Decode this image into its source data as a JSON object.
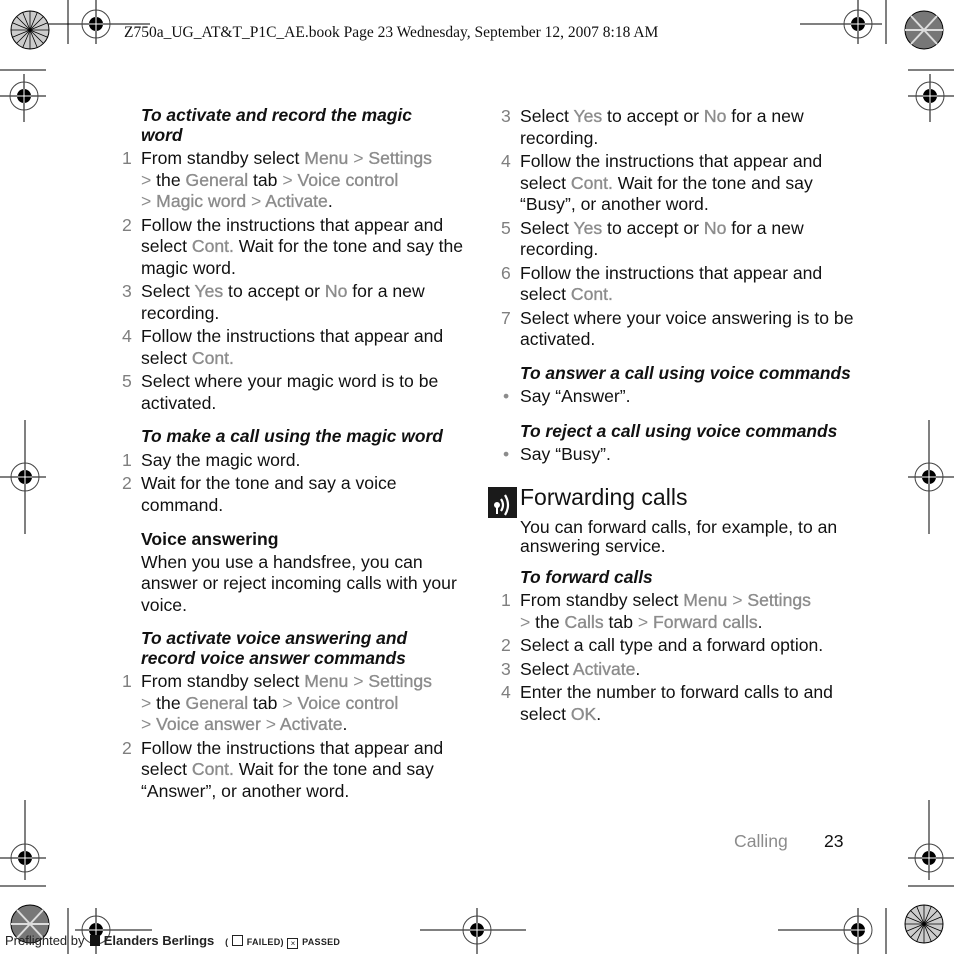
{
  "header": {
    "running_head": "Z750a_UG_AT&T_P1C_AE.book  Page 23  Wednesday, September 12, 2007  8:18 AM"
  },
  "left_column": {
    "section1": {
      "title": "To activate and record the magic word",
      "title_line1": "To activate and record the magic",
      "title_line2": "word",
      "steps": [
        {
          "num": "1",
          "parts": [
            "From standby select ",
            "Menu",
            " > ",
            "Settings",
            "\n> ",
            "the ",
            "General",
            " tab ",
            "> ",
            "Voice control",
            "\n> ",
            "Magic word",
            " > ",
            "Activate",
            "."
          ]
        },
        {
          "num": "2",
          "text_a": "Follow the instructions that appear and select ",
          "menu": "Cont.",
          "text_b": " Wait for the tone and say the magic word."
        },
        {
          "num": "3",
          "text_a": "Select ",
          "yes": "Yes",
          "text_b": " to accept or ",
          "no": "No",
          "text_c": " for a new recording."
        },
        {
          "num": "4",
          "text_a": "Follow the instructions that appear and select ",
          "menu": "Cont."
        },
        {
          "num": "5",
          "text": "Select where your magic word is to be activated."
        }
      ],
      "step1": {
        "a": "From standby select ",
        "menu": "Menu",
        "gt": ">",
        "settings": "Settings",
        "the": "the ",
        "general": "General",
        "tab": " tab ",
        "voice_control": "Voice control",
        "magic_word": "Magic word",
        "activate": "Activate",
        "period": "."
      }
    },
    "section2": {
      "title": "To make a call using the magic word",
      "steps": [
        {
          "num": "1",
          "text": "Say the magic word."
        },
        {
          "num": "2",
          "text": "Wait for the tone and say a voice command."
        }
      ]
    },
    "section3": {
      "subheading": "Voice answering",
      "body": "When you use a handsfree, you can answer or reject incoming calls with your voice."
    },
    "section4": {
      "title_line1": "To activate voice answering and",
      "title_line2": "record voice answer commands",
      "step1": {
        "num": "1",
        "a": "From standby select ",
        "menu": "Menu",
        "gt": ">",
        "settings": "Settings",
        "the": "the ",
        "general": "General",
        "tab": " tab ",
        "voice_control": "Voice control",
        "voice_answer": "Voice answer",
        "activate": "Activate",
        "period": "."
      },
      "step2": {
        "num": "2",
        "text_a": "Follow the instructions that appear and select ",
        "menu": "Cont.",
        "text_b": " Wait for the tone and say “Answer”, or another word."
      }
    }
  },
  "right_column": {
    "steps_cont": [
      {
        "num": "3",
        "text_a": "Select ",
        "yes": "Yes",
        "text_b": " to accept or ",
        "no": "No",
        "text_c": " for a new recording."
      },
      {
        "num": "4",
        "text_a": "Follow the instructions that appear and select ",
        "menu": "Cont.",
        "text_b": " Wait for the tone and say “Busy”, or another word."
      },
      {
        "num": "5",
        "text_a": "Select ",
        "yes": "Yes",
        "text_b": " to accept or ",
        "no": "No",
        "text_c": " for a new recording."
      },
      {
        "num": "6",
        "text_a": "Follow the instructions that appear and select ",
        "menu": "Cont."
      },
      {
        "num": "7",
        "text": "Select where your voice answering is to be activated."
      }
    ],
    "answer_section": {
      "title": "To answer a call using voice commands",
      "bullet": "Say “Answer”."
    },
    "reject_section": {
      "title": "To reject a call using voice commands",
      "bullet": "Say “Busy”."
    },
    "forwarding": {
      "heading": "Forwarding calls",
      "icon": "calls-icon",
      "intro": "You can forward calls, for example, to an answering service.",
      "subtitle": "To forward calls",
      "step1": {
        "num": "1",
        "a": "From standby select ",
        "menu": "Menu",
        "gt": ">",
        "settings": "Settings",
        "the": "the ",
        "calls": "Calls",
        "tab": " tab ",
        "forward_calls": "Forward calls",
        "period": "."
      },
      "step2": {
        "num": "2",
        "text": "Select a call type and a forward option."
      },
      "step3": {
        "num": "3",
        "a": "Select ",
        "activate": "Activate",
        "period": "."
      },
      "step4": {
        "num": "4",
        "a": "Enter the number to forward calls to and select ",
        "ok": "OK",
        "period": "."
      }
    }
  },
  "footer": {
    "section": "Calling",
    "page_number": "23"
  },
  "preflight": {
    "label": "Preflighted by",
    "brand": "Elanders Berlings",
    "failed": "FAILED",
    "passed": "PASSED",
    "passed_mark": "×"
  },
  "colors": {
    "menu_text": "#8c8c8c",
    "step_number": "#7f7f7f",
    "body_text": "#111111"
  }
}
